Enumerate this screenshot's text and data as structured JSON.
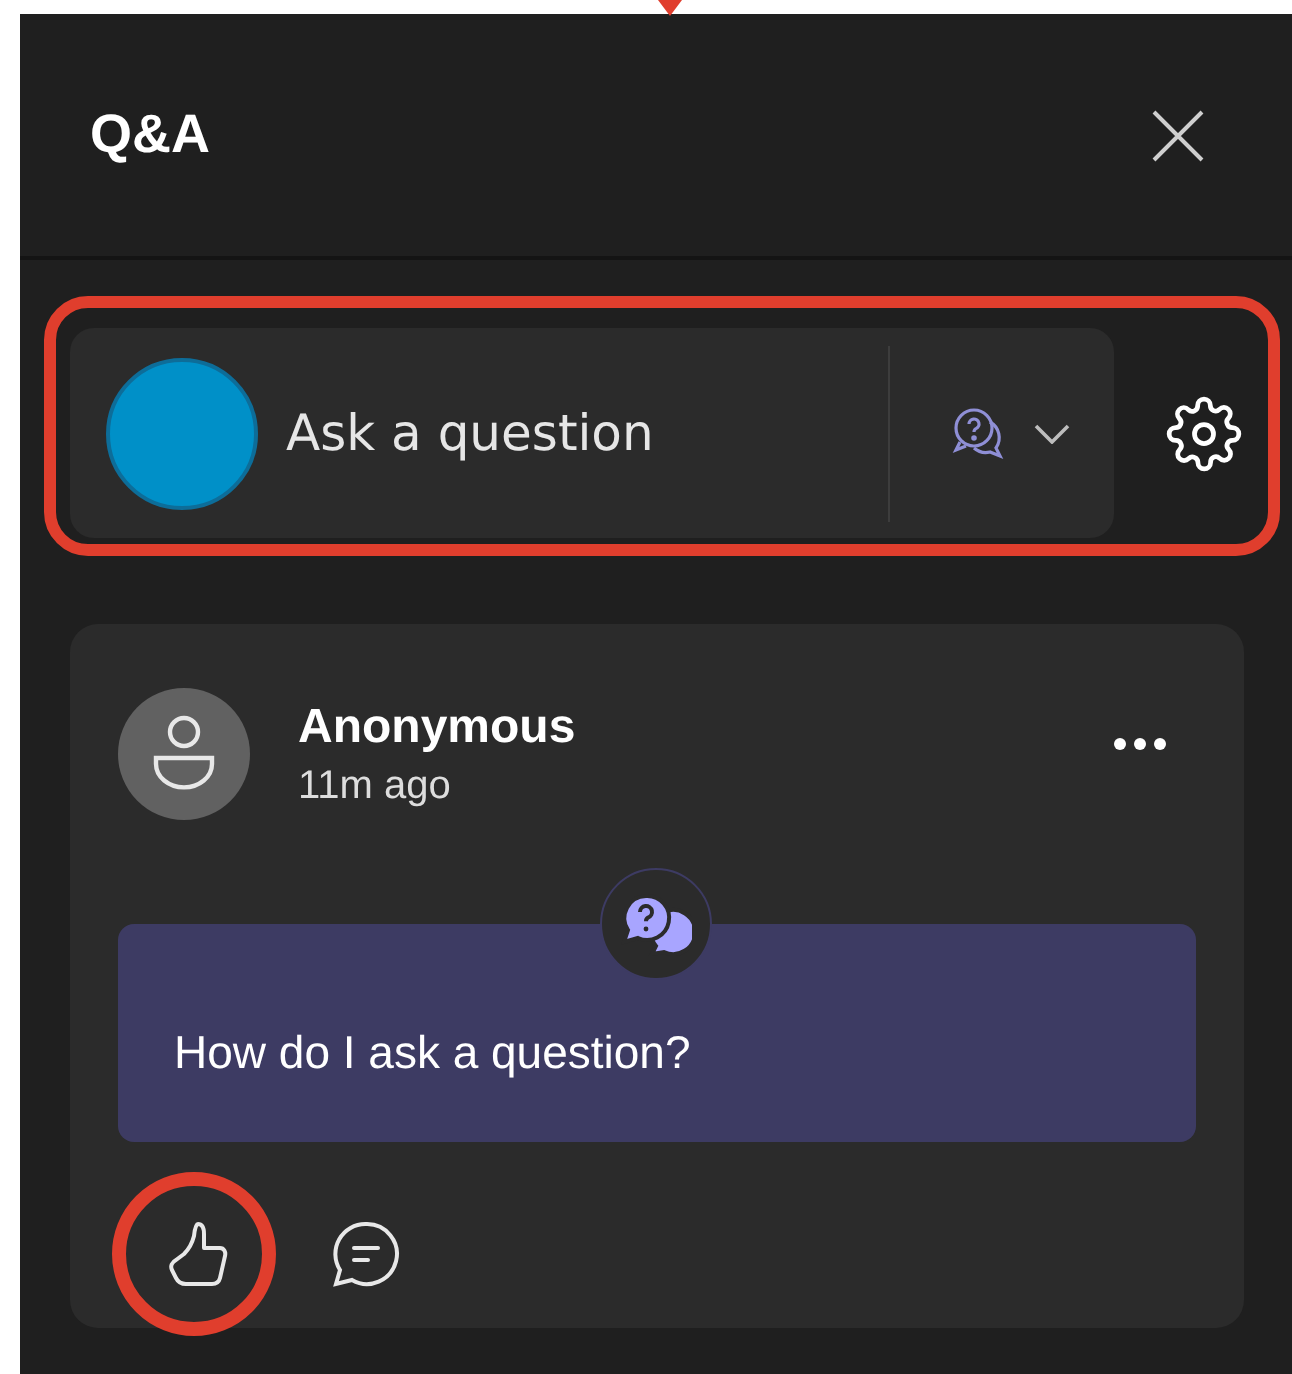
{
  "panel": {
    "title": "Q&A"
  },
  "composer": {
    "placeholder": "Ask a question"
  },
  "questions": [
    {
      "author": "Anonymous",
      "time": "11m ago",
      "text": "How do I ask a question?"
    }
  ]
}
